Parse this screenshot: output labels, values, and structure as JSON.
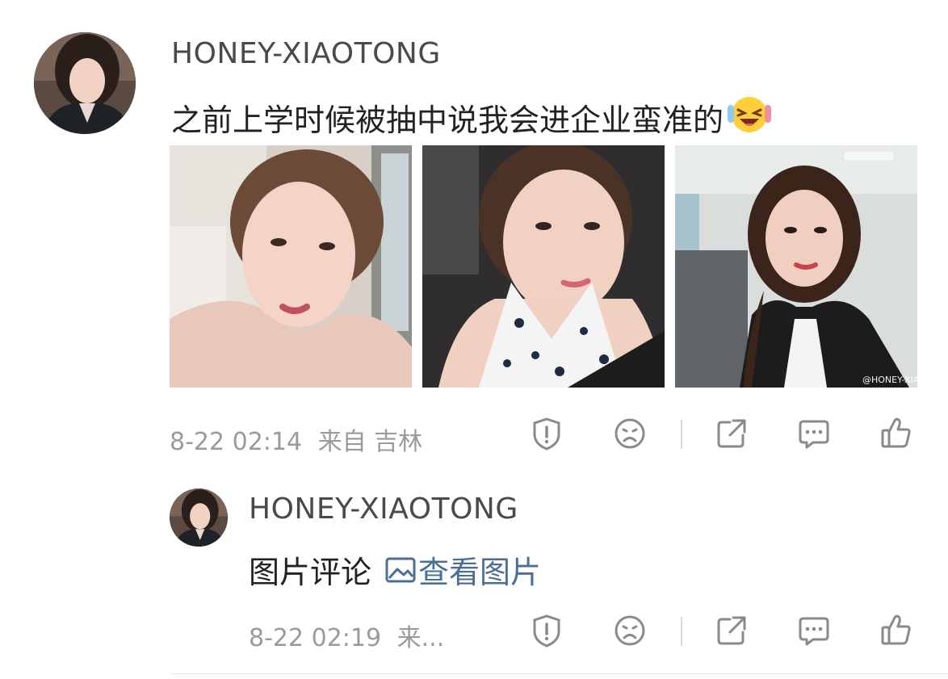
{
  "post": {
    "username": "HONEY-XIAOTONG",
    "text": "之前上学时候被抽中说我会进企业蛮准的",
    "emoji": "laughing-crying-emoji",
    "photos": [
      {
        "name": "selfie-photo-1"
      },
      {
        "name": "selfie-photo-2"
      },
      {
        "name": "selfie-photo-3",
        "watermark": "@HONEY-XIA"
      }
    ],
    "time": "8-22 02:14",
    "source": "来自 吉林"
  },
  "reply": {
    "username": "HONEY-XIAOTONG",
    "text": "图片评论",
    "link_text": "查看图片",
    "time": "8-22 02:19",
    "source": "来..."
  },
  "actions": [
    "report-icon",
    "dislike-icon",
    "share-icon",
    "comment-icon",
    "like-icon"
  ],
  "colors": {
    "link": "#4b6f94",
    "meta": "#9a9a9a",
    "username": "#4a4a4a",
    "icon": "#8a8a8a"
  }
}
